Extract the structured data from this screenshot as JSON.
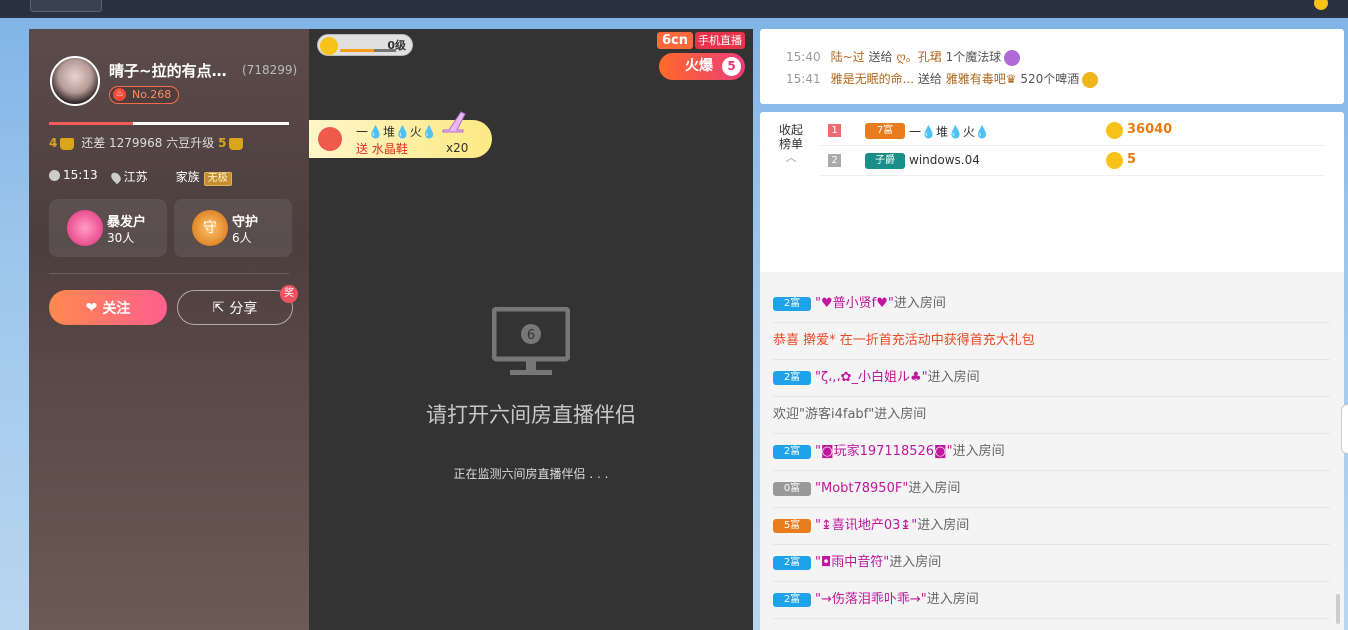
{
  "topbar": {
    "crumbs": ""
  },
  "profile": {
    "name": "晴子~拉的有点…",
    "id": "(718299)",
    "rank": "No.268",
    "level_progress": 0.35,
    "level_current": "4",
    "level_text": "还差 1279968 六豆升级",
    "level_next": "5",
    "time": "15:13",
    "location": "江苏",
    "family_label": "家族",
    "family_tag": "无极",
    "rich_title": "暴发户",
    "rich_count": "30人",
    "rich_badge": "",
    "guard_title": "守护",
    "guard_count": "6人",
    "guard_badge": "守",
    "follow_label": "关注",
    "share_label": "分享",
    "reward_badge": "奖"
  },
  "video": {
    "level_label": "0级",
    "gift_toast": {
      "who": "一💧堆💧火💧",
      "what": "送 水晶鞋",
      "qty": "x20"
    },
    "brand": "6cn",
    "mobile_live": "手机直播",
    "hot_label": "火爆",
    "hot_num": "5",
    "monitor_digit": "6",
    "open_text": "请打开六间房直播伴侣",
    "detect_text": "正在监测六间房直播伴侣 . . ."
  },
  "gifts": [
    {
      "time": "15:40",
      "from": "陆~过",
      "verb": "送给",
      "to": "ღ。孔珺",
      "item": "1个魔法球",
      "icon_color": "#b06ad8"
    },
    {
      "time": "15:41",
      "from": "雅是无眠的命...",
      "verb": "送给",
      "to": "雅雅有毒吧♛",
      "item": "520个啤酒",
      "icon_color": "#f0b51a"
    }
  ],
  "rank": {
    "toggle": "收起\n榜单",
    "rows": [
      {
        "no": "1",
        "no_color": "#f06a73",
        "tag": "7富",
        "tag_color": "#e87d1e",
        "name": "一💧堆💧火💧",
        "amount": "36040"
      },
      {
        "no": "2",
        "no_color": "#aaaaaa",
        "tag": "子爵",
        "tag_color": "#1a8f8a",
        "name": "windows.04",
        "amount": "5"
      }
    ]
  },
  "chat": [
    {
      "type": "enter",
      "lv": "2富",
      "lv_color": "#1fa3e8",
      "user": "\"♥普小贤f♥\"",
      "suffix": "进入房间"
    },
    {
      "type": "sys",
      "text": "恭喜 擀爱* 在一折首充活动中获得首充大礼包"
    },
    {
      "type": "enter",
      "lv": "2富",
      "lv_color": "#1fa3e8",
      "user": "\"ζ،,،✿_小白姐ル♣\"",
      "suffix": "进入房间"
    },
    {
      "type": "welcome",
      "text": "欢迎\"游客i4fabf\"进入房间"
    },
    {
      "type": "enter",
      "lv": "2富",
      "lv_color": "#1fa3e8",
      "user": "\"◙玩家197118526◙\"",
      "suffix": "进入房间"
    },
    {
      "type": "enter",
      "lv": "0富",
      "lv_color": "#999999",
      "user": "\"Mobt78950F\"",
      "suffix": "进入房间"
    },
    {
      "type": "enter",
      "lv": "5富",
      "lv_color": "#e87d1e",
      "user": "\"↨喜讯地产03↨\"",
      "suffix": "进入房间"
    },
    {
      "type": "enter",
      "lv": "2富",
      "lv_color": "#1fa3e8",
      "user": "\"◘雨中音符\"",
      "suffix": "进入房间"
    },
    {
      "type": "enter",
      "lv": "2富",
      "lv_color": "#1fa3e8",
      "user": "\"→伤落泪乖卟乖→\"",
      "suffix": "进入房间"
    }
  ]
}
